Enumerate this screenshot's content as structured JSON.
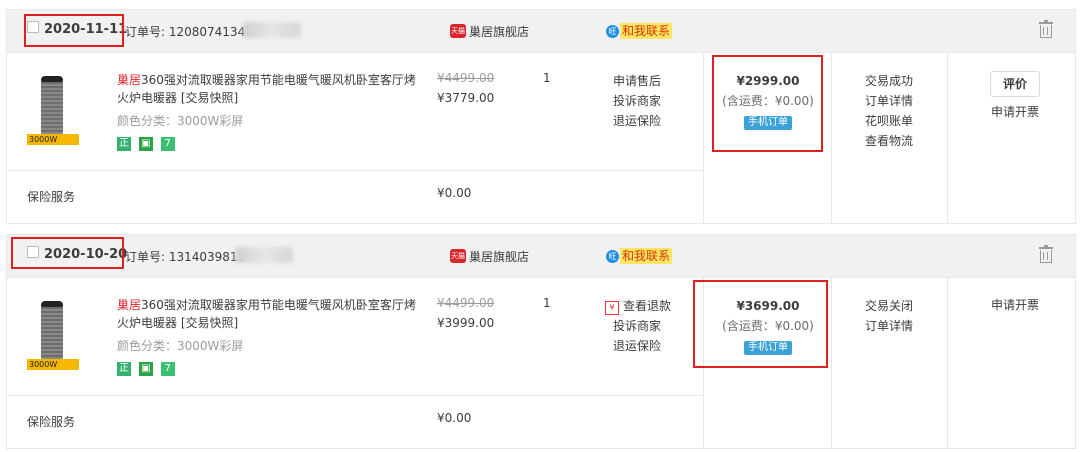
{
  "orders": [
    {
      "date": "2020-11-11",
      "order_no_label": "订单号: 12080741347",
      "shop_badge": "天猫",
      "shop_name": "巢居旗舰店",
      "ww_icon": "旺",
      "contact_label": "和我联系",
      "product": {
        "image_tag": "3000W",
        "brand": "巢居",
        "title": "360强对流取暖器家用节能电暖气暖风机卧室客厅烤火炉电暖器 [交易快照]",
        "spec": "颜色分类：3000W彩屏",
        "badges": [
          "正",
          "",
          "7"
        ]
      },
      "original_price": "¥4499.00",
      "price": "¥3779.00",
      "quantity": "1",
      "services": [
        "申请售后",
        "投诉商家",
        "退运保险"
      ],
      "total": "¥2999.00",
      "shipping": "(含运费：¥0.00)",
      "mobile_tag": "手机订单",
      "status": [
        "交易成功",
        "订单详情",
        "花呗账单",
        "查看物流"
      ],
      "rate_button": "评价",
      "invoice_link": "申请开票",
      "insurance_label": "保险服务",
      "insurance_price": "¥0.00"
    },
    {
      "date": "2020-10-20",
      "order_no_label": "订单号: 1314039816",
      "shop_badge": "天猫",
      "shop_name": "巢居旗舰店",
      "ww_icon": "旺",
      "contact_label": "和我联系",
      "product": {
        "image_tag": "3000W",
        "brand": "巢居",
        "title": "360强对流取暖器家用节能电暖气暖风机卧室客厅烤火炉电暖器 [交易快照]",
        "spec": "颜色分类：3000W彩屏",
        "badges": [
          "正",
          "",
          "7"
        ]
      },
      "original_price": "¥4499.00",
      "price": "¥3999.00",
      "quantity": "1",
      "refund_icon": "¥",
      "services": [
        "查看退款",
        "投诉商家",
        "退运保险"
      ],
      "total": "¥3699.00",
      "shipping": "(含运费：¥0.00)",
      "mobile_tag": "手机订单",
      "status": [
        "交易关闭",
        "订单详情"
      ],
      "invoice_link": "申请开票",
      "insurance_label": "保险服务",
      "insurance_price": "¥0.00"
    }
  ],
  "highlight_color": "#e02020"
}
